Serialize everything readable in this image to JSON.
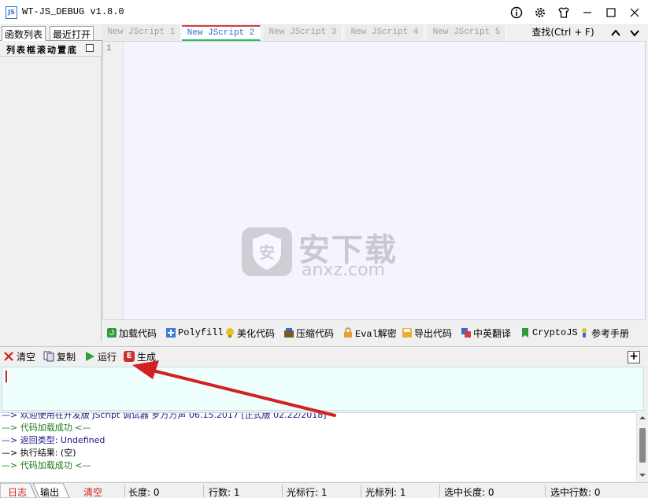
{
  "window": {
    "title": "WT-JS_DEBUG v1.8.0",
    "icon_text": "JS"
  },
  "left_panel": {
    "tabs": [
      {
        "label": "函数列表"
      },
      {
        "label": "最近打开"
      }
    ],
    "header": "列表框滚动置底"
  },
  "editor_tabs": [
    {
      "label": "New JScript 1",
      "active": false
    },
    {
      "label": "New JScript 2",
      "active": true
    },
    {
      "label": "New JScript 3",
      "active": false
    },
    {
      "label": "New JScript 4",
      "active": false
    },
    {
      "label": "New JScript 5",
      "active": false
    }
  ],
  "find_label": "查找(Ctrl + F)",
  "editor": {
    "line_number": "1",
    "watermark_text": "安下载",
    "watermark_sub": "anxz.com",
    "watermark_badge": "安"
  },
  "toolbar": {
    "items": [
      {
        "label": "加载代码",
        "icon": "load-icon"
      },
      {
        "label": "Polyfill",
        "icon": "polyfill-icon"
      },
      {
        "label": "美化代码",
        "icon": "beautify-icon"
      },
      {
        "label": "压缩代码",
        "icon": "compress-icon"
      },
      {
        "label": "Eval解密",
        "icon": "lock-icon"
      },
      {
        "label": "导出代码",
        "icon": "export-icon"
      },
      {
        "label": "中英翻译",
        "icon": "translate-icon"
      },
      {
        "label": "CryptoJS",
        "icon": "crypto-icon"
      },
      {
        "label": "参考手册",
        "icon": "manual-icon"
      }
    ]
  },
  "actions": {
    "clear": "清空",
    "copy": "复制",
    "run": "运行",
    "generate": "生成",
    "generate_badge": "E",
    "add": "+"
  },
  "log": {
    "lines": [
      {
        "text": "—> 欢迎使用在开发版 JScript 调试器   罗万万声   06.15.2017   [正式版   02.22/2018]",
        "color": "#1a1a8a"
      },
      {
        "text": "—> 代码加载成功 <—",
        "color": "#1a7a1a"
      },
      {
        "text": "—> 返回类型: Undefined",
        "color": "#1a1a8a"
      },
      {
        "text": "—> 执行结果: (空)",
        "color": "#000000"
      },
      {
        "text": "—> 代码加载成功 <—",
        "color": "#1a7a1a"
      }
    ]
  },
  "bottom_tabs": {
    "log": "日志",
    "output": "输出",
    "clear": "清空"
  },
  "status": {
    "length": "长度: 0",
    "lines": "行数: 1",
    "cursor_row": "光标行: 1",
    "cursor_col": "光标列: 1",
    "sel_length": "选中长度: 0",
    "sel_lines": "选中行数: 0"
  },
  "colors": {
    "accent_blue": "#2a6fc9",
    "arrow_red": "#d42020",
    "input_bg": "#effffe",
    "editor_bg": "#f4f4ff"
  }
}
